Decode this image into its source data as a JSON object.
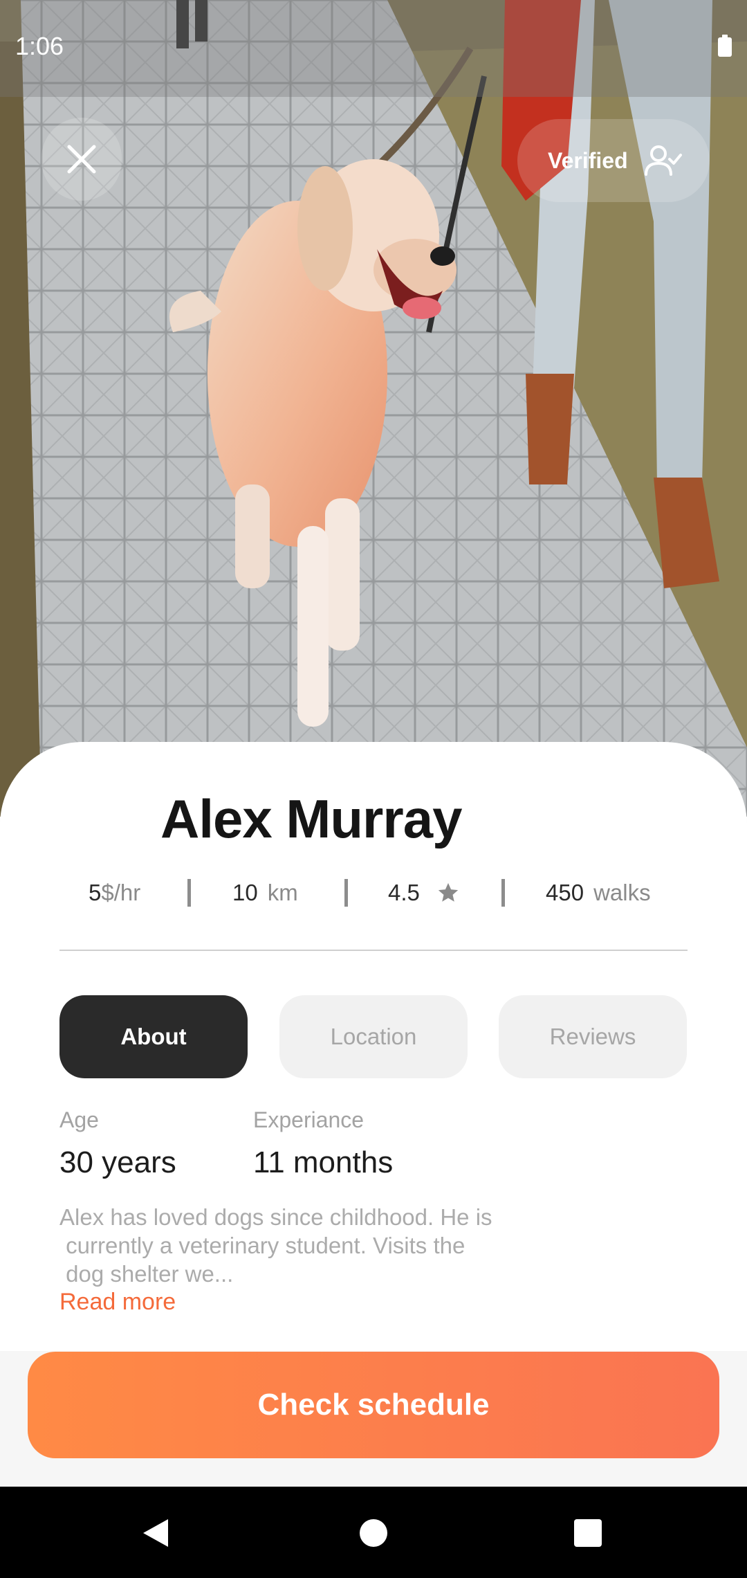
{
  "status_bar": {
    "time": "1:06",
    "battery_icon": "battery-full-icon"
  },
  "top_actions": {
    "close_icon": "close-icon",
    "verified_label": "Verified",
    "verified_icon": "user-check-icon"
  },
  "hero": {
    "description_icon": "dog-walking-photo"
  },
  "profile": {
    "name": "Alex Murray",
    "stats": {
      "rate_value": "5",
      "rate_unit": "$/hr",
      "distance_value": "10",
      "distance_unit": "km",
      "rating_value": "4.5",
      "rating_icon": "star-icon",
      "walks_value": "450",
      "walks_unit": "walks"
    }
  },
  "tabs": [
    {
      "label": "About",
      "active": true
    },
    {
      "label": "Location",
      "active": false
    },
    {
      "label": "Reviews",
      "active": false
    }
  ],
  "about": {
    "age_label": "Age",
    "age_value": "30 years",
    "experience_label": "Experiance",
    "experience_value": "11 months",
    "bio_lines": [
      "Alex has loved dogs since childhood. He is",
      " currently a veterinary student. Visits the",
      " dog shelter we..."
    ],
    "read_more": "Read more"
  },
  "cta": {
    "label": "Check schedule"
  },
  "nav_bar": {
    "back_icon": "back-triangle-icon",
    "home_icon": "home-circle-icon",
    "recents_icon": "recents-square-icon"
  },
  "colors": {
    "accent": "#f46a3a",
    "cta_start": "#ff8a45",
    "cta_end": "#fa7452",
    "active_tab": "#2a2a2a"
  }
}
